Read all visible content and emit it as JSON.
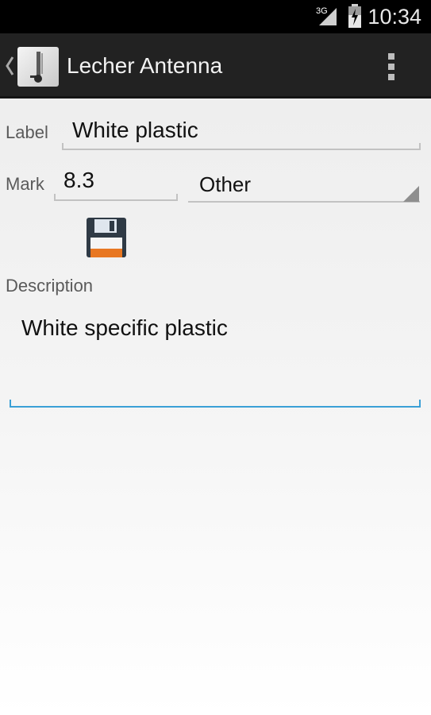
{
  "status_bar": {
    "network": "3G",
    "time": "10:34",
    "icons": [
      "signal-icon",
      "battery-icon"
    ]
  },
  "action_bar": {
    "title": "Lecher Antenna",
    "icons": [
      "back-chevron-icon",
      "app-icon",
      "overflow-menu-icon"
    ]
  },
  "form": {
    "label_caption": "Label",
    "label_value": "White plastic",
    "mark_caption": "Mark",
    "mark_value": "8.3",
    "unit_selected": "Other",
    "save_icon": "floppy-disk-icon",
    "description_caption": "Description",
    "description_value": "White specific plastic"
  },
  "colors": {
    "action_bar": "#222222",
    "focus_underline": "#3aa0d6",
    "save_accent": "#e87722"
  }
}
